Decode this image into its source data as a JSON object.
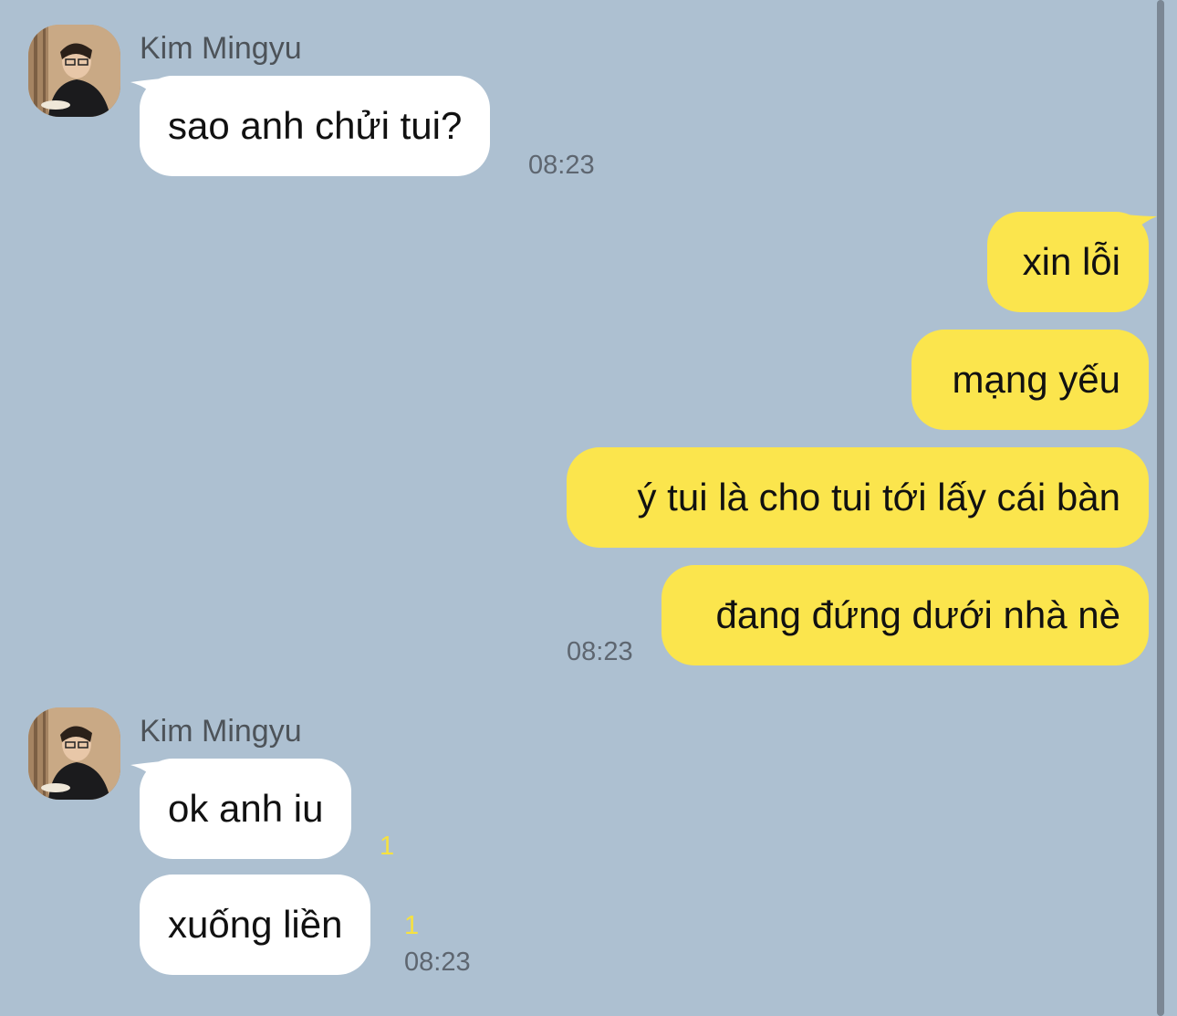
{
  "chat": {
    "contact_name": "Kim Mingyu",
    "groups": [
      {
        "sender": "Kim Mingyu",
        "messages": [
          {
            "text": "sao anh chửi tui?"
          }
        ],
        "time": "08:23"
      },
      {
        "sender": "me",
        "messages": [
          {
            "text": "xin lỗi"
          },
          {
            "text": "mạng yếu"
          },
          {
            "text": "ý tui là cho tui tới lấy cái bàn"
          },
          {
            "text": "đang đứng dưới nhà nè"
          }
        ],
        "time": "08:23"
      },
      {
        "sender": "Kim Mingyu",
        "messages": [
          {
            "text": "ok anh iu",
            "unread": "1"
          },
          {
            "text": "xuống liền",
            "unread": "1"
          }
        ],
        "time": "08:23"
      }
    ]
  },
  "colors": {
    "background": "#adc0d1",
    "incoming_bubble": "#ffffff",
    "outgoing_bubble": "#fbe54d",
    "unread_count": "#f6e140"
  },
  "icons": {
    "avatar": "contact-photo"
  }
}
